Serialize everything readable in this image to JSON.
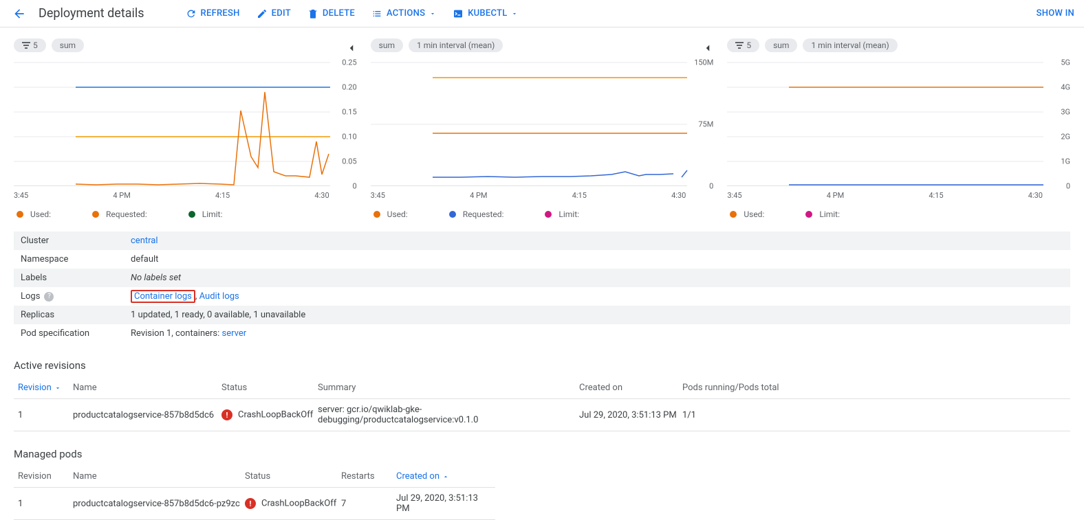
{
  "header": {
    "title": "Deployment details",
    "refresh": "REFRESH",
    "edit": "EDIT",
    "delete": "DELETE",
    "actions": "ACTIONS",
    "kubectl": "KUBECTL",
    "show_in": "SHOW IN"
  },
  "charts": [
    {
      "filter": "5",
      "chips": [
        "sum"
      ]
    },
    {
      "chips": [
        "sum",
        "1 min interval (mean)"
      ]
    },
    {
      "filter": "5",
      "chips": [
        "sum",
        "1 min interval (mean)"
      ]
    }
  ],
  "chart_data": [
    {
      "type": "line",
      "x_labels": [
        "3:45",
        "4 PM",
        "4:15",
        "4:30"
      ],
      "y_ticks": [
        "0.25",
        "0.20",
        "0.15",
        "0.10",
        "0.05",
        "0"
      ],
      "ylim": [
        0,
        0.25
      ],
      "series": [
        {
          "name": "Used",
          "color": "#e8710a",
          "values": [
            null,
            0.005,
            0.004,
            0.006,
            0.005,
            0.004,
            0.006,
            0.005,
            0.004,
            0.005,
            0.006,
            0.15,
            0.06,
            0.04,
            0.18,
            0.03,
            0.02,
            0.02,
            0.04,
            0.1,
            0.06
          ]
        },
        {
          "name": "Requested",
          "color": "#e8710a",
          "values": [
            null,
            0.1,
            0.1,
            0.1,
            0.1,
            0.1,
            0.1,
            0.1,
            0.1,
            0.1,
            0.1,
            0.1,
            0.1,
            0.1,
            0.1,
            0.1,
            0.1,
            0.1,
            0.1,
            0.1,
            0.1
          ]
        },
        {
          "name": "Limit",
          "color": "#0d652d",
          "values": [
            null,
            0.2,
            0.2,
            0.2,
            0.2,
            0.2,
            0.2,
            0.2,
            0.2,
            0.2,
            0.2,
            0.2,
            0.2,
            0.2,
            0.2,
            0.2,
            0.2,
            0.2,
            0.2,
            0.2,
            0.2
          ]
        }
      ],
      "legend": [
        "Used:",
        "Requested:",
        "Limit:"
      ]
    },
    {
      "type": "line",
      "x_labels": [
        "3:45",
        "4 PM",
        "4:15",
        "4:30"
      ],
      "y_ticks": [
        "150M",
        "75M",
        "0"
      ],
      "ylim": [
        0,
        150
      ],
      "series": [
        {
          "name": "Used",
          "color": "#3367d6",
          "values": [
            null,
            12,
            12,
            13,
            12,
            12,
            13,
            13,
            12,
            14,
            13,
            14,
            13,
            18,
            20,
            16,
            18,
            null,
            23
          ]
        },
        {
          "name": "Requested",
          "color": "#e8710a",
          "values": [
            null,
            64,
            64,
            64,
            64,
            64,
            64,
            64,
            64,
            64,
            64,
            64,
            64,
            64,
            64,
            64,
            64,
            64,
            64
          ]
        },
        {
          "name": "Limit",
          "color": "#d01884",
          "values": [
            null,
            128,
            128,
            128,
            128,
            128,
            128,
            128,
            128,
            128,
            128,
            128,
            128,
            128,
            128,
            128,
            128,
            128,
            128
          ]
        }
      ],
      "legend": [
        "Used:",
        "Requested:",
        "Limit:"
      ]
    },
    {
      "type": "line",
      "x_labels": [
        "3:45",
        "4 PM",
        "4:15",
        "4:30"
      ],
      "y_ticks": [
        "5G",
        "4G",
        "3G",
        "2G",
        "1G",
        "0"
      ],
      "ylim": [
        0,
        5
      ],
      "series": [
        {
          "name": "Used",
          "color": "#3367d6",
          "values": [
            null,
            0.05,
            0.05,
            0.05,
            0.05,
            0.05,
            0.05,
            0.05,
            0.05,
            0.05,
            0.05,
            0.05,
            0.05,
            0.05,
            0.05,
            0.05,
            0.05,
            0.05,
            0.05
          ]
        },
        {
          "name": "Limit",
          "color": "#d01884",
          "values": [
            null,
            4,
            4,
            4,
            4,
            4,
            4,
            4,
            4,
            4,
            4,
            4,
            4,
            4,
            4,
            4,
            4,
            4,
            4
          ]
        }
      ],
      "legend": [
        "Used:",
        "Limit:"
      ]
    }
  ],
  "kv": {
    "cluster_k": "Cluster",
    "cluster_v": "central",
    "ns_k": "Namespace",
    "ns_v": "default",
    "labels_k": "Labels",
    "labels_v": "No labels set",
    "logs_k": "Logs",
    "logs_container": "Container logs",
    "logs_audit": "Audit logs",
    "replicas_k": "Replicas",
    "replicas_v": "1 updated, 1 ready, 0 available, 1 unavailable",
    "podspec_k": "Pod specification",
    "podspec_pre": "Revision 1, containers: ",
    "podspec_link": "server"
  },
  "rev": {
    "title": "Active revisions",
    "h_revision": "Revision",
    "h_name": "Name",
    "h_status": "Status",
    "h_summary": "Summary",
    "h_created": "Created on",
    "h_pods": "Pods running/Pods total",
    "r1_rev": "1",
    "r1_name": "productcatalogservice-857b8d5dc6",
    "r1_status": "CrashLoopBackOff",
    "r1_summary": "server: gcr.io/qwiklab-gke-debugging/productcatalogservice:v0.1.0",
    "r1_created": "Jul 29, 2020, 3:51:13 PM",
    "r1_pods": "1/1"
  },
  "pods": {
    "title": "Managed pods",
    "h_revision": "Revision",
    "h_name": "Name",
    "h_status": "Status",
    "h_restarts": "Restarts",
    "h_created": "Created on",
    "r1_rev": "1",
    "r1_name": "productcatalogservice-857b8d5dc6-pz9zc",
    "r1_status": "CrashLoopBackOff",
    "r1_restarts": "7",
    "r1_created": "Jul 29, 2020, 3:51:13 PM"
  }
}
